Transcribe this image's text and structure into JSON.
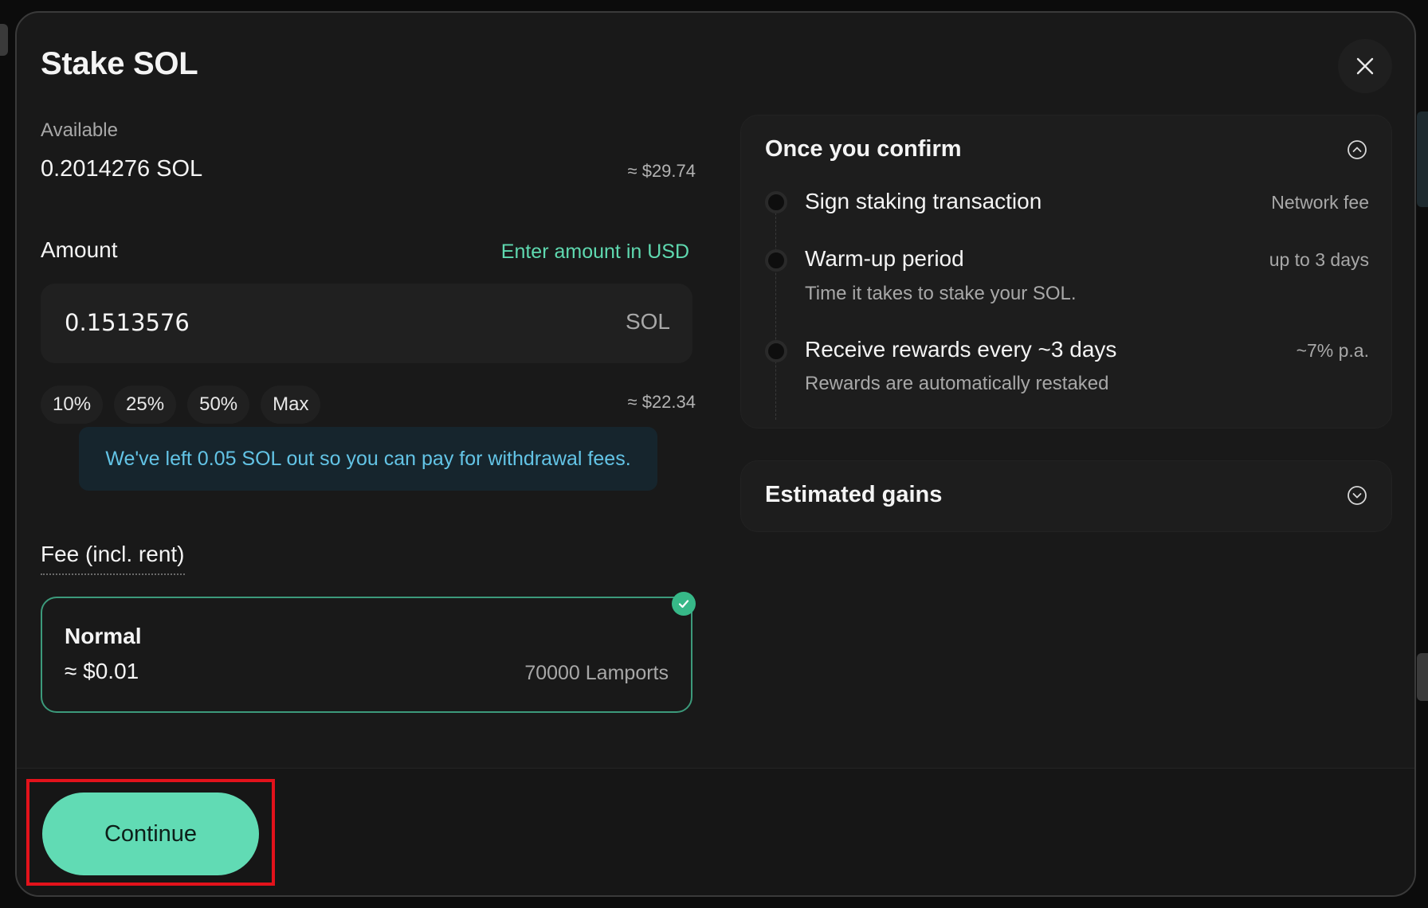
{
  "modal": {
    "title": "Stake SOL",
    "close_icon": "close-icon"
  },
  "available": {
    "label": "Available",
    "value": "0.2014276 SOL",
    "usd": "≈ $29.74"
  },
  "amount": {
    "label": "Amount",
    "usd_toggle": "Enter amount in USD",
    "input_value": "0.1513576",
    "unit": "SOL",
    "usd": "≈ $22.34",
    "percent_buttons": [
      "10%",
      "25%",
      "50%",
      "Max"
    ]
  },
  "notice": "We've left 0.05 SOL out so you can pay for withdrawal fees.",
  "fee": {
    "label": "Fee (incl. rent)",
    "option_name": "Normal",
    "option_usd": "≈ $0.01",
    "option_lamports": "70000 Lamports",
    "selected": true
  },
  "confirm": {
    "title": "Once you confirm",
    "expanded": true,
    "steps": [
      {
        "title": "Sign staking transaction",
        "subtitle": "",
        "right": "Network fee"
      },
      {
        "title": "Warm-up period",
        "subtitle": "Time it takes to stake your SOL.",
        "right": "up to 3 days"
      },
      {
        "title": "Receive rewards every ~3 days",
        "subtitle": "Rewards are automatically restaked",
        "right": "~7% p.a."
      }
    ]
  },
  "gains": {
    "title": "Estimated gains",
    "expanded": false
  },
  "footer": {
    "continue_label": "Continue"
  },
  "colors": {
    "accent": "#61dbb4",
    "notice_text": "#63c4e6",
    "highlight": "#e3121b"
  }
}
